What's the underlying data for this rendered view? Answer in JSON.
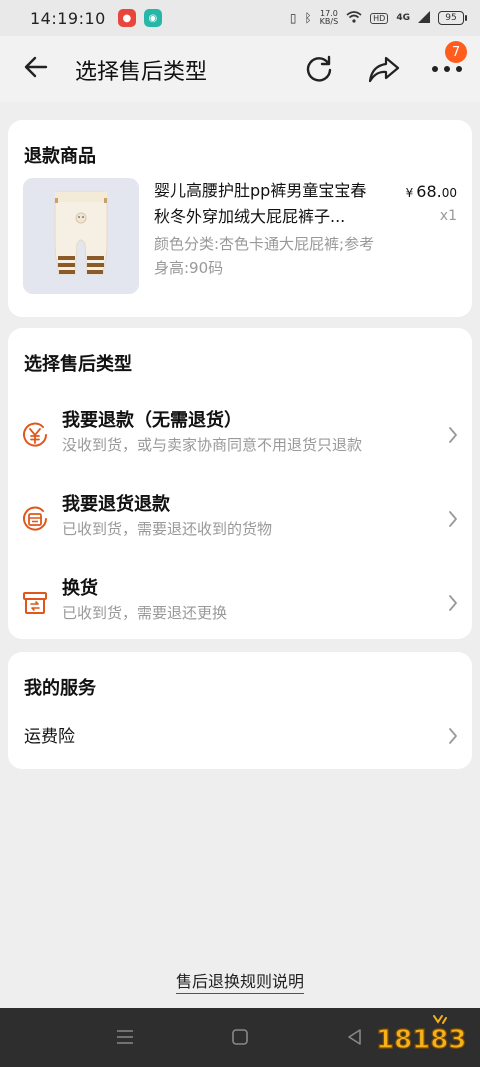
{
  "status": {
    "time": "14:19:10",
    "speed_top": "17.0",
    "speed_bottom": "KB/S",
    "hd": "HD",
    "network": "4G",
    "battery": "95"
  },
  "header": {
    "title": "选择售后类型",
    "badge_count": "7"
  },
  "product_card": {
    "title": "退款商品",
    "name": "婴儿高腰护肚pp裤男童宝宝春秋冬外穿加绒大屁屁裤子...",
    "spec": "颜色分类:杏色卡通大屁屁裤;参考身高:90码",
    "price_symbol": "¥",
    "price_int": "68.",
    "price_dec": "00",
    "quantity": "x1"
  },
  "type_card": {
    "title": "选择售后类型",
    "options": [
      {
        "title": "我要退款（无需退货）",
        "desc": "没收到货，或与卖家协商同意不用退货只退款",
        "icon": "yen-circle-icon"
      },
      {
        "title": "我要退货退款",
        "desc": "已收到货，需要退还收到的货物",
        "icon": "return-box-icon"
      },
      {
        "title": "换货",
        "desc": "已收到货，需要退还更换",
        "icon": "exchange-box-icon"
      }
    ]
  },
  "service_card": {
    "title": "我的服务",
    "items": [
      {
        "label": "运费险"
      }
    ]
  },
  "footer": {
    "rules_link": "售后退换规则说明"
  },
  "watermark": {
    "text": "18183"
  },
  "colors": {
    "accent": "#e0571c",
    "badge": "#ff5c1e",
    "page_bg": "#eeeeee",
    "muted_text": "#999999"
  }
}
